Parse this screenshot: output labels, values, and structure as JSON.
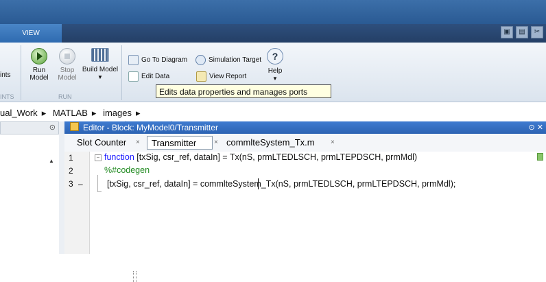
{
  "ribbon": {
    "active_tab": "VIEW",
    "left_partial_label": "ints",
    "left_section_partial": "INTS",
    "run_section_label": "RUN",
    "buttons": {
      "run": [
        "Run",
        "Model"
      ],
      "stop": [
        "Stop",
        "Model"
      ],
      "build": "Build Model",
      "go_to_diagram": "Go To Diagram",
      "simulation_target": "Simulation Target",
      "edit_data": "Edit Data",
      "view_report": "View Report",
      "help": "Help"
    }
  },
  "tooltip": "Edits data properties and manages ports",
  "breadcrumb": [
    "ual_Work",
    "MATLAB",
    "images"
  ],
  "editor": {
    "title": "Editor - Block: MyModel0/Transmitter",
    "tabs": [
      "Slot Counter",
      "Transmitter",
      "commlteSystem_Tx.m"
    ],
    "active_tab_index": 1,
    "lines": [
      {
        "num": "1",
        "marker": "",
        "keyword": "function",
        "text": " [txSig, csr_ref, dataIn] = Tx(nS, prmLTEDLSCH, prmLTEPDSCH, prmMdl)"
      },
      {
        "num": "2",
        "marker": "",
        "comment": "%#codegen"
      },
      {
        "num": "3",
        "marker": "–",
        "text": "[txSig, csr_ref, dataIn] = commlteSystem_Tx(nS, prmLTEDLSCH, prmLTEPDSCH, prmMdl);"
      }
    ]
  }
}
